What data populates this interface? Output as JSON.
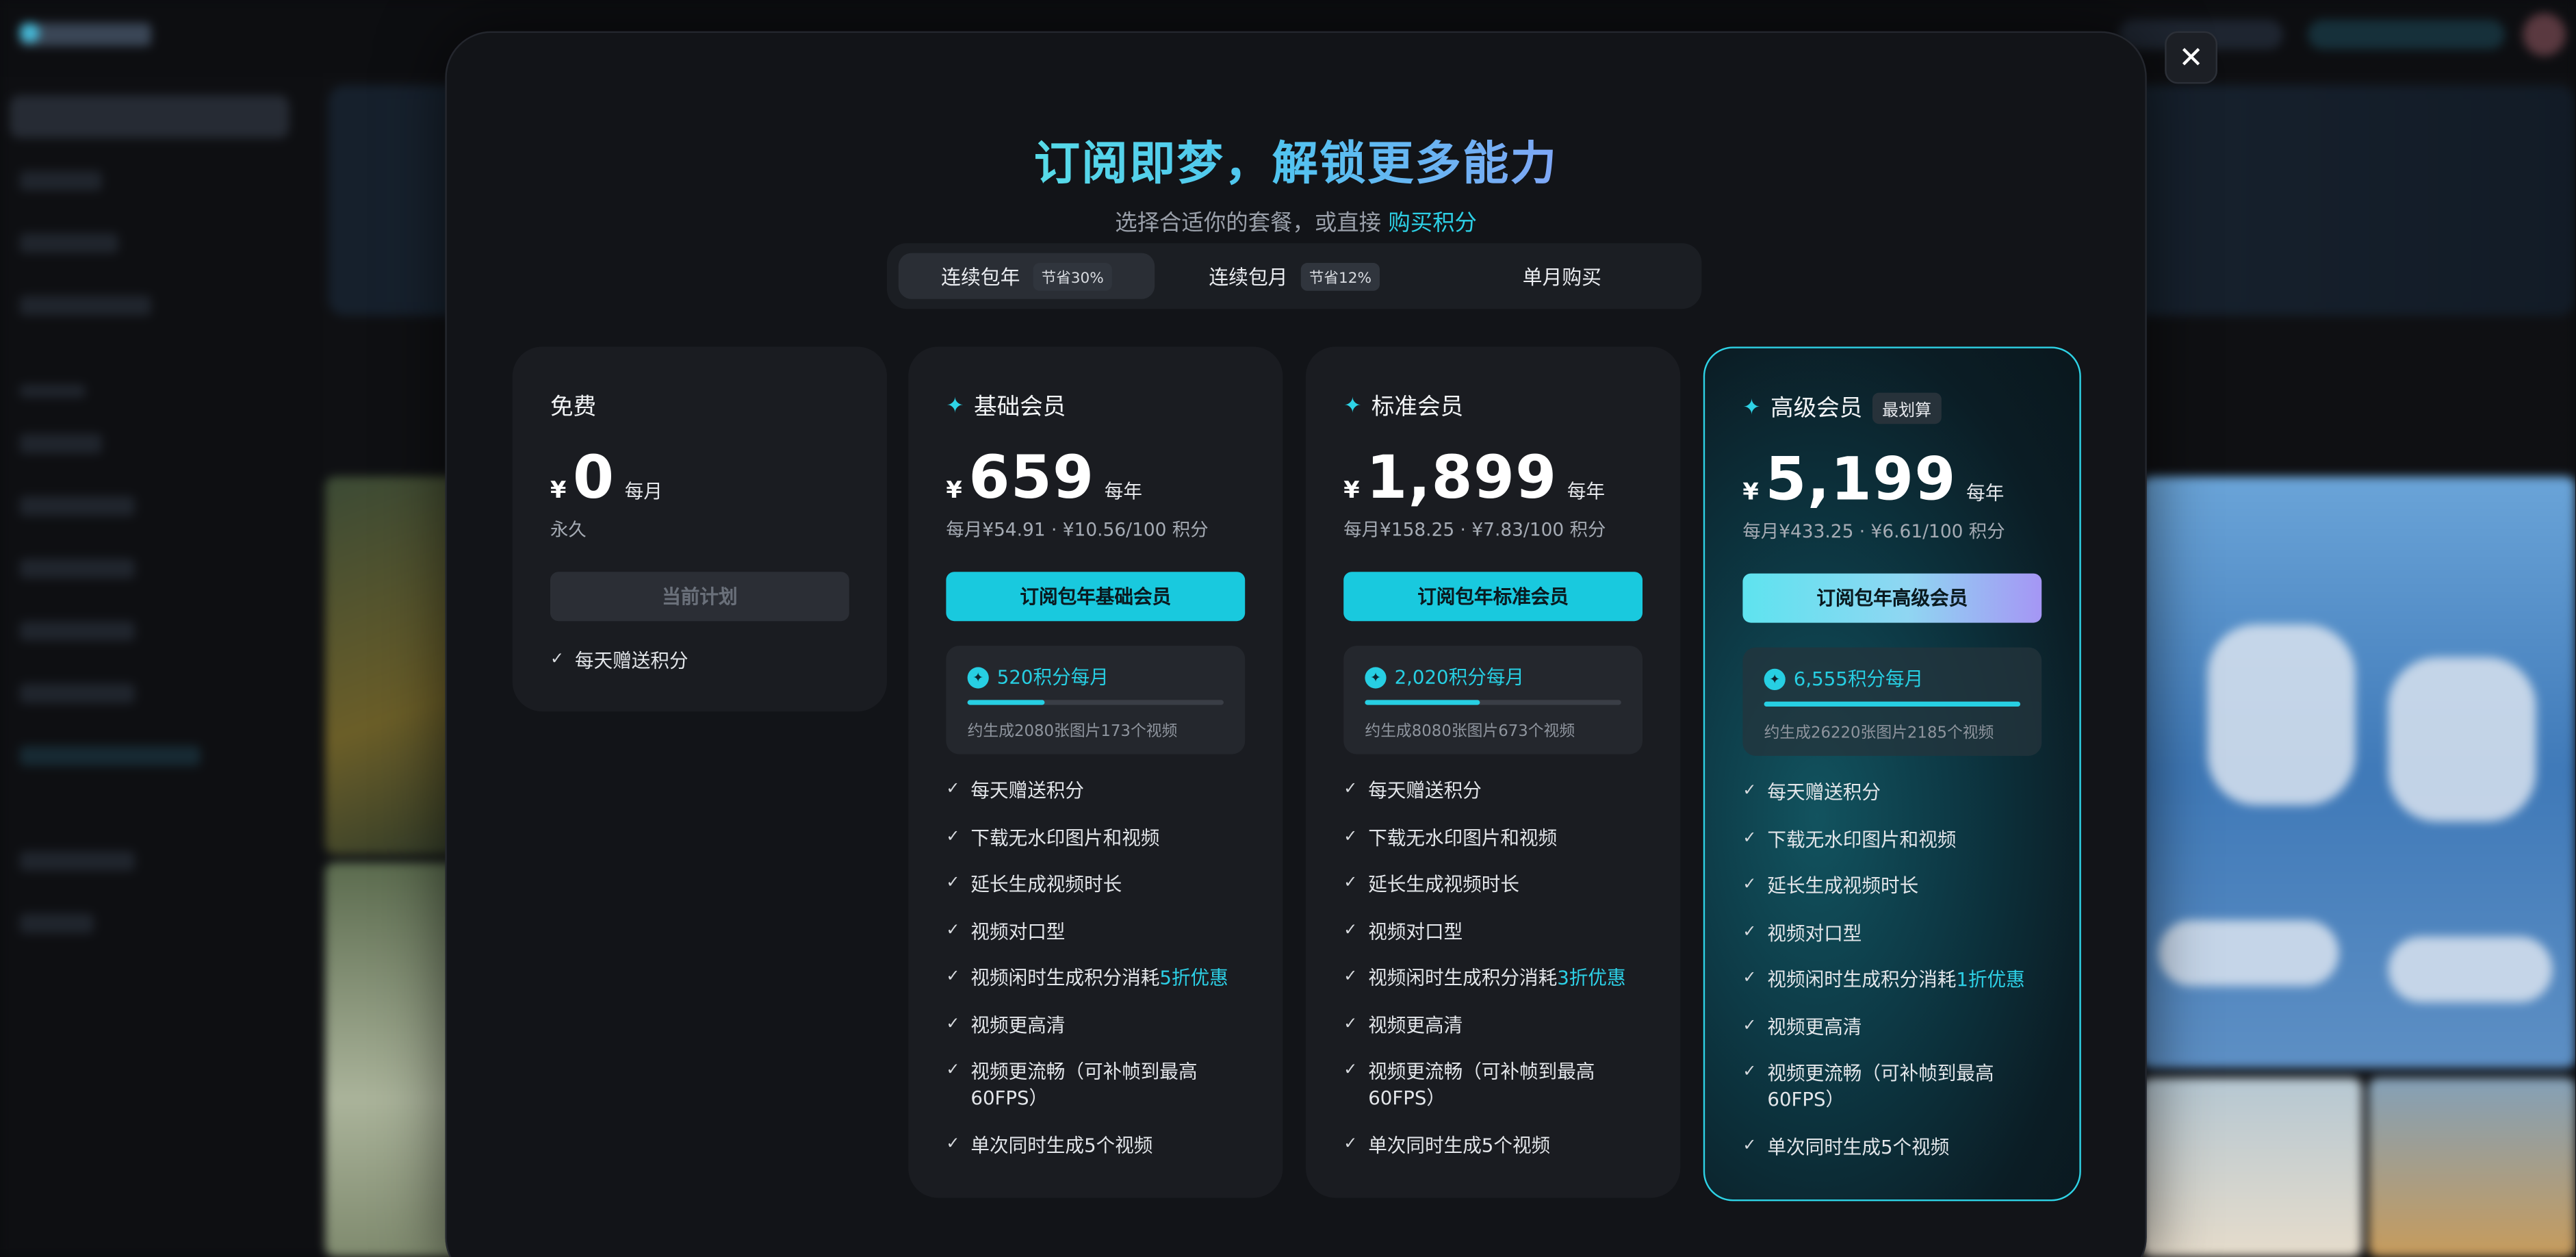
{
  "modal": {
    "title": "订阅即梦，解锁更多能力",
    "subtitle_prefix": "选择合适你的套餐，或直接",
    "subtitle_link": "购买积分",
    "close_icon": "close-icon"
  },
  "tabs": [
    {
      "label": "连续包年",
      "badge": "节省30%",
      "active": true
    },
    {
      "label": "连续包月",
      "badge": "节省12%",
      "active": false
    },
    {
      "label": "单月购买",
      "badge": "",
      "active": false
    }
  ],
  "plans": {
    "free": {
      "name": "免费",
      "currency": "¥",
      "price": "0",
      "period": "每月",
      "note": "永久",
      "cta": "当前计划",
      "features": [
        "每天赠送积分"
      ]
    },
    "basic": {
      "name": "基础会员",
      "currency": "¥",
      "price": "659",
      "period": "每年",
      "note": "每月¥54.91 · ¥10.56/100 积分",
      "cta": "订阅包年基础会员",
      "credits": "520积分每月",
      "credits_sub": "约生成2080张图片173个视频",
      "credits_fill": 0.3,
      "features": [
        "每天赠送积分",
        "下载无水印图片和视频",
        "延长生成视频时长",
        "视频对口型"
      ],
      "discount_prefix": "视频闲时生成积分消耗",
      "discount_hl": "5折优惠",
      "features2": [
        "视频更高清",
        "视频更流畅（可补帧到最高60FPS）",
        "单次同时生成5个视频"
      ]
    },
    "standard": {
      "name": "标准会员",
      "currency": "¥",
      "price": "1,899",
      "period": "每年",
      "note": "每月¥158.25 · ¥7.83/100 积分",
      "cta": "订阅包年标准会员",
      "credits": "2,020积分每月",
      "credits_sub": "约生成8080张图片673个视频",
      "credits_fill": 0.45,
      "features": [
        "每天赠送积分",
        "下载无水印图片和视频",
        "延长生成视频时长",
        "视频对口型"
      ],
      "discount_prefix": "视频闲时生成积分消耗",
      "discount_hl": "3折优惠",
      "features2": [
        "视频更高清",
        "视频更流畅（可补帧到最高60FPS）",
        "单次同时生成5个视频"
      ]
    },
    "premium": {
      "name": "高级会员",
      "tag": "最划算",
      "currency": "¥",
      "price": "5,199",
      "period": "每年",
      "note": "每月¥433.25 · ¥6.61/100 积分",
      "cta": "订阅包年高级会员",
      "credits": "6,555积分每月",
      "credits_sub": "约生成26220张图片2185个视频",
      "credits_fill": 1.0,
      "features": [
        "每天赠送积分",
        "下载无水印图片和视频",
        "延长生成视频时长",
        "视频对口型"
      ],
      "discount_prefix": "视频闲时生成积分消耗",
      "discount_hl": "1折优惠",
      "features2": [
        "视频更高清",
        "视频更流畅（可补帧到最高60FPS）",
        "单次同时生成5个视频"
      ]
    }
  },
  "colors": {
    "accent": "#27cfe3",
    "card_bg": "#1a1c21",
    "modal_bg": "#121418"
  }
}
